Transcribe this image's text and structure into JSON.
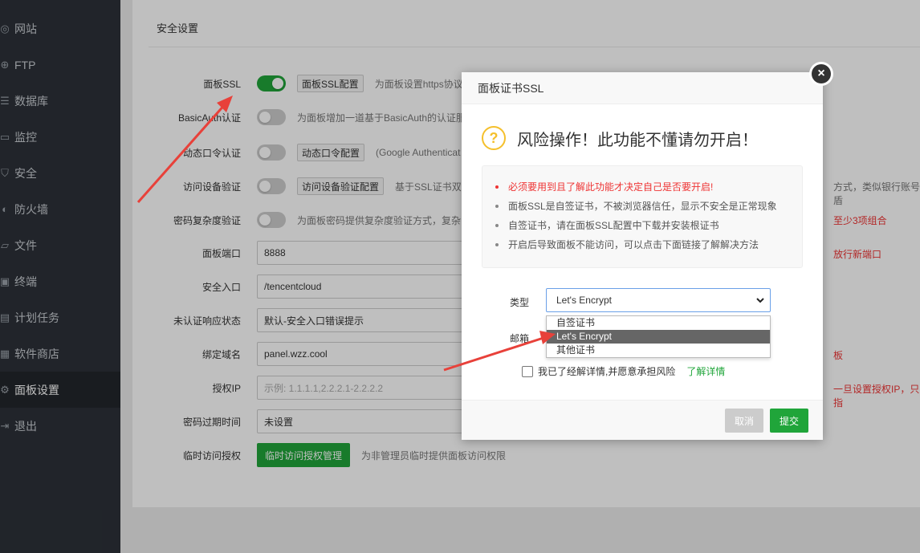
{
  "sidebar": {
    "items": [
      {
        "label": "网站",
        "icon": "globe-icon",
        "glyph": "◎"
      },
      {
        "label": "FTP",
        "icon": "ftp-icon",
        "glyph": "⊕"
      },
      {
        "label": "数据库",
        "icon": "database-icon",
        "glyph": "☰"
      },
      {
        "label": "监控",
        "icon": "monitor-icon",
        "glyph": "▭"
      },
      {
        "label": "安全",
        "icon": "shield-icon",
        "glyph": "⛉"
      },
      {
        "label": "防火墙",
        "icon": "firewall-icon",
        "glyph": "◐"
      },
      {
        "label": "文件",
        "icon": "folder-icon",
        "glyph": "▱"
      },
      {
        "label": "终端",
        "icon": "terminal-icon",
        "glyph": "▣"
      },
      {
        "label": "计划任务",
        "icon": "calendar-icon",
        "glyph": "▤"
      },
      {
        "label": "软件商店",
        "icon": "grid-icon",
        "glyph": "▦"
      },
      {
        "label": "面板设置",
        "icon": "gear-icon",
        "glyph": "⚙",
        "active": true
      },
      {
        "label": "退出",
        "icon": "logout-icon",
        "glyph": "⇥"
      }
    ]
  },
  "section_title": "安全设置",
  "settings": {
    "panel_ssl": {
      "label": "面板SSL",
      "button": "面板SSL配置",
      "hint": "为面板设置https协议"
    },
    "basic_auth": {
      "label": "BasicAuth认证",
      "hint": "为面板增加一道基于BasicAuth的认证服"
    },
    "dynamic_code": {
      "label": "动态口令认证",
      "button": "动态口令配置",
      "hint": "(Google Authenticat"
    },
    "device_verify": {
      "label": "访问设备验证",
      "button": "访问设备验证配置",
      "hint": "基于SSL证书双向",
      "hint_right": "方式，类似银行账号U盾"
    },
    "password_complexity": {
      "label": "密码复杂度验证",
      "hint": "为面板密码提供复杂度验证方式，复杂",
      "hint_right": "至少3项组合"
    },
    "panel_port": {
      "label": "面板端口",
      "value": "8888",
      "hint_right": "放行新端口"
    },
    "security_entry": {
      "label": "安全入口",
      "value": "/tencentcloud"
    },
    "unauth_response": {
      "label": "未认证响应状态",
      "value": "默认-安全入口错误提示"
    },
    "bind_domain": {
      "label": "绑定域名",
      "value": "panel.wzz.cool",
      "hint_right": "板"
    },
    "auth_ip": {
      "label": "授权IP",
      "placeholder": "示例: 1.1.1.1,2.2.2.1-2.2.2.2",
      "hint_right": "一旦设置授权IP，只有指"
    },
    "password_expire": {
      "label": "密码过期时间",
      "value": "未设置"
    },
    "temp_access": {
      "label": "临时访问授权",
      "button": "临时访问授权管理",
      "hint": "为非管理员临时提供面板访问权限"
    }
  },
  "dialog": {
    "title": "面板证书SSL",
    "warn_title": "风险操作！此功能不懂请勿开启！",
    "notes": [
      "必须要用到且了解此功能才决定自己是否要开启!",
      "面板SSL是自签证书，不被浏览器信任，显示不安全是正常现象",
      "自签证书，请在面板SSL配置中下载并安装根证书",
      "开启后导致面板不能访问，可以点击下面链接了解解决方法"
    ],
    "type_label": "类型",
    "type_value": "Let's Encrypt",
    "type_options": [
      "自签证书",
      "Let's Encrypt",
      "其他证书"
    ],
    "email_label": "邮箱",
    "agree_text": "我已了经解详情,并愿意承担风险",
    "agree_link": "了解详情",
    "cancel": "取消",
    "submit": "提交",
    "close_glyph": "×"
  },
  "colors": {
    "accent": "#20a53a",
    "sidebar": "#2c3138",
    "warning": "#f5c02c",
    "arrow": "#e8413a"
  }
}
